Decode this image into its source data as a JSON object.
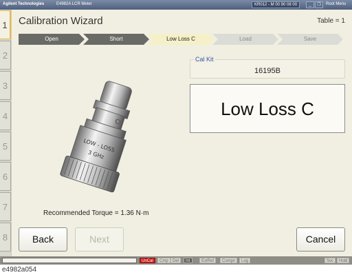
{
  "titlebar": {
    "brand": "Agilent Technologies",
    "app_name": "E4982A LCR Meter",
    "status": "KR012 - M 00 90 08 00",
    "root_menu": "Root Menu"
  },
  "sidetabs": [
    "1",
    "2",
    "3",
    "4",
    "5",
    "6",
    "7",
    "8"
  ],
  "wizard": {
    "title": "Calibration Wizard",
    "table": "Table = 1",
    "steps": [
      {
        "label": "Open",
        "state": "done"
      },
      {
        "label": "Short",
        "state": "done"
      },
      {
        "label": "Low Loss C",
        "state": "current"
      },
      {
        "label": "Load",
        "state": "todo"
      },
      {
        "label": "Save",
        "state": "todo"
      }
    ],
    "cal_kit_label": "Cal Kit",
    "cal_kit_value": "16195B",
    "standard": "Low Loss C",
    "connector_text_1": "LOW - LOSS",
    "connector_text_2": "3 GHz",
    "torque": "Recommended Torque = 1.36 N·m",
    "back_label": "Back",
    "next_label": "Next",
    "cancel_label": "Cancel"
  },
  "statusbar": {
    "indicators": [
      "UnCal",
      "Cmp",
      "Del",
      "Int",
      "ExtRef",
      "Compn",
      "Log"
    ],
    "right": [
      "Svc",
      "Hold"
    ]
  },
  "caption": "e4982a054",
  "colors": {
    "panel": "#f1efe1",
    "step_done": "#6a6a66",
    "step_current": "#f5f0c8",
    "uncal": "#cc1c1c",
    "active_tab_border": "#e8b84a"
  }
}
